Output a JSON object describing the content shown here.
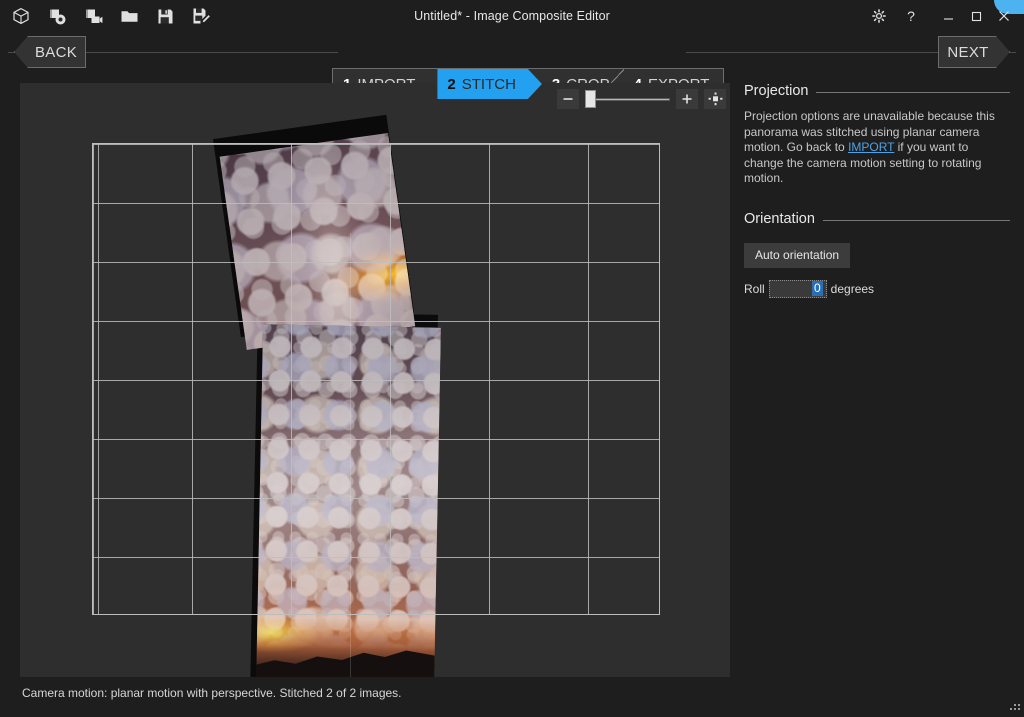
{
  "window": {
    "title": "Untitled* - Image Composite Editor",
    "accent_color": "#4db2f0",
    "background_color": "#1e1e1e"
  },
  "toolbar": {
    "items": [
      {
        "name": "new-panorama-icon",
        "tooltip": "New panorama"
      },
      {
        "name": "add-images-icon",
        "tooltip": "Add images"
      },
      {
        "name": "add-video-icon",
        "tooltip": "Add video frames"
      },
      {
        "name": "open-folder-icon",
        "tooltip": "Open"
      },
      {
        "name": "save-icon",
        "tooltip": "Save"
      },
      {
        "name": "save-as-icon",
        "tooltip": "Save as"
      }
    ]
  },
  "window_controls": {
    "settings_label": "⚙",
    "help_label": "?",
    "minimize_label": "—",
    "maximize_label": "□",
    "close_label": "✕"
  },
  "nav": {
    "back_label": "BACK",
    "next_label": "NEXT",
    "active_step": "2 STITCH",
    "steps": [
      {
        "num": "1",
        "label": "IMPORT",
        "active": false
      },
      {
        "num": "2",
        "label": "STITCH",
        "active": true
      },
      {
        "num": "3",
        "label": "CROP",
        "active": false
      },
      {
        "num": "4",
        "label": "EXPORT",
        "active": false
      }
    ]
  },
  "canvas": {
    "zoom": {
      "zoom_out_label": "−",
      "zoom_in_label": "+",
      "fit_to_window_name": "fit-to-window-icon",
      "slider_value": 0,
      "slider_min": 0,
      "slider_max": 100
    }
  },
  "panel": {
    "projection": {
      "title": "Projection",
      "text_before_link": "Projection options are unavailable because this panorama was stitched using planar camera motion. Go back to ",
      "link_label": "IMPORT",
      "text_after_link": " if you want to change the camera motion setting to rotating motion."
    },
    "orientation": {
      "title": "Orientation",
      "auto_orientation_label": "Auto orientation",
      "roll_label": "Roll",
      "roll_value": "0",
      "roll_units": "degrees"
    }
  },
  "status": {
    "text": "Camera motion: planar motion with perspective. Stitched 2 of 2 images."
  }
}
